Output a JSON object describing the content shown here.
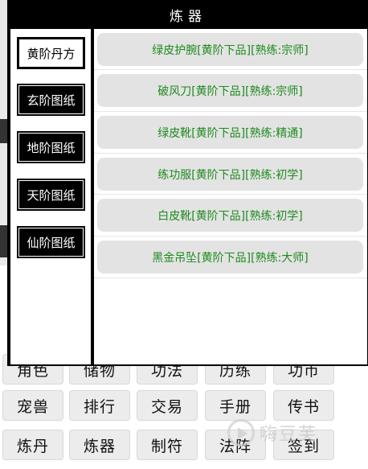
{
  "dialog": {
    "title": "炼器"
  },
  "categories": [
    {
      "label": "黄阶丹方",
      "active": true
    },
    {
      "label": "玄阶图纸",
      "active": false
    },
    {
      "label": "地阶图纸",
      "active": false
    },
    {
      "label": "天阶图纸",
      "active": false
    },
    {
      "label": "仙阶图纸",
      "active": false
    }
  ],
  "items": [
    "绿皮护腕[黄阶下品][熟练:宗师]",
    "破风刀[黄阶下品][熟练:宗师]",
    "绿皮靴[黄阶下品][熟练:精通]",
    "练功服[黄阶下品][熟练:初学]",
    "白皮靴[黄阶下品][熟练:初学]",
    "黑金吊坠[黄阶下品][熟练:大师]"
  ],
  "menu": {
    "row1": [
      "角色",
      "储物",
      "功法",
      "历练",
      "功币"
    ],
    "row2": [
      "宠兽",
      "排行",
      "交易",
      "手册",
      "传书"
    ],
    "row3": [
      "炼丹",
      "炼器",
      "制符",
      "法阵",
      "签到"
    ]
  },
  "watermark": {
    "text": "嗨豆芙"
  },
  "colors": {
    "item_text": "#1e8a1e",
    "dialog_bg": "#000000",
    "item_bg": "#e3e3e3"
  }
}
